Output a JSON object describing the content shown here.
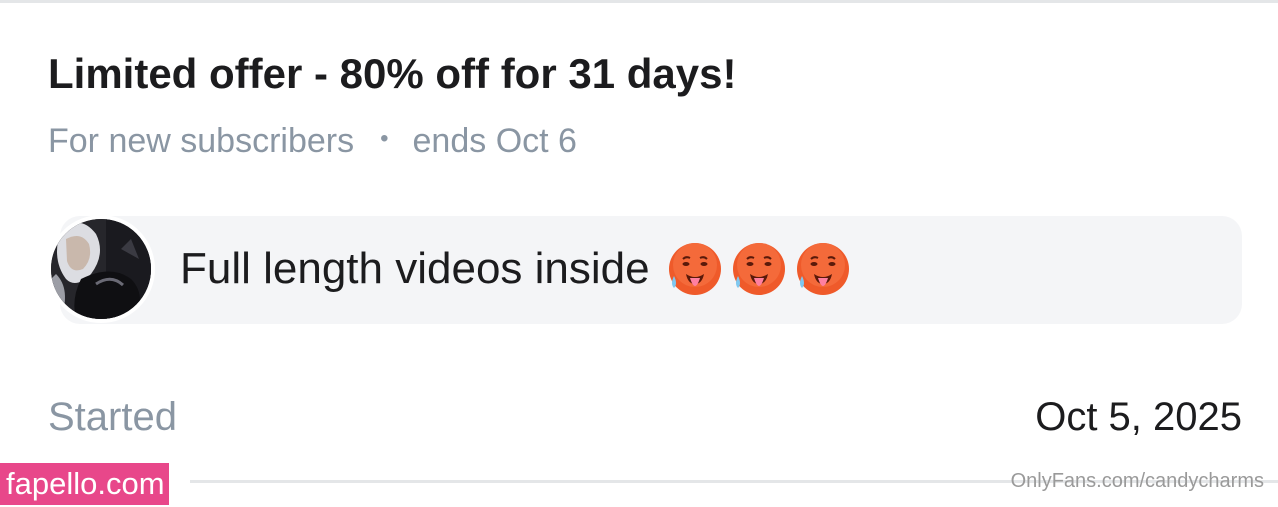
{
  "offer": {
    "title": "Limited offer - 80% off for 31 days!",
    "audience": "For new subscribers",
    "separator": "•",
    "ends": "ends Oct 6"
  },
  "message": {
    "text": "Full length videos inside",
    "emojis": [
      "hot-face-icon",
      "hot-face-icon",
      "hot-face-icon"
    ],
    "avatar": "creator-avatar"
  },
  "started": {
    "label": "Started",
    "date": "Oct 5, 2025"
  },
  "watermarks": {
    "left": "fapello.com",
    "right": "OnlyFans.com/candycharms"
  },
  "colors": {
    "muted_text": "#8a96a3",
    "primary_text": "#1c1c1e",
    "bubble_bg": "#f4f5f7",
    "watermark_pink": "#e8478a"
  }
}
